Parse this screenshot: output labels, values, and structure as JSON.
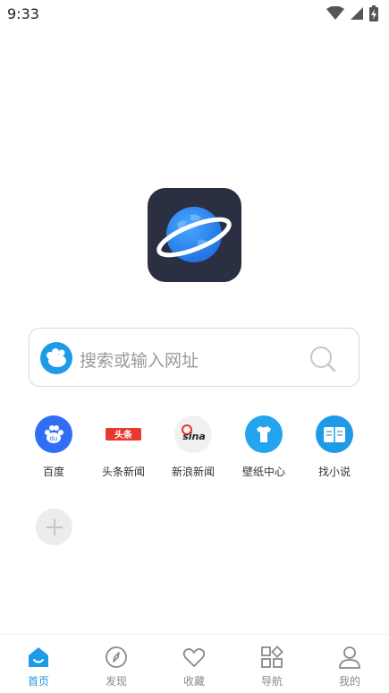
{
  "status_bar": {
    "time": "9:33",
    "icons": [
      "wifi-icon",
      "signal-icon",
      "battery-icon"
    ]
  },
  "app": {
    "logo_icon": "planet-globe-icon"
  },
  "search": {
    "placeholder": "搜索或输入网址",
    "engine_icon": "baidu-paw-icon",
    "search_icon": "search-icon"
  },
  "shortcuts": [
    {
      "label": "百度",
      "icon": "baidu-icon",
      "color": "#2f6ff6"
    },
    {
      "label": "头条新闻",
      "icon": "toutiao-icon",
      "color": "#e8382f"
    },
    {
      "label": "新浪新闻",
      "icon": "sina-icon",
      "color": "#e8362f"
    },
    {
      "label": "壁纸中心",
      "icon": "tshirt-icon",
      "color": "#22a5ee"
    },
    {
      "label": "找小说",
      "icon": "book-icon",
      "color": "#1f9ae7"
    }
  ],
  "add_shortcut": {
    "icon": "plus-icon"
  },
  "bottom_nav": {
    "items": [
      {
        "label": "首页",
        "icon": "home-icon",
        "active": true
      },
      {
        "label": "发现",
        "icon": "compass-icon",
        "active": false
      },
      {
        "label": "收藏",
        "icon": "heart-icon",
        "active": false
      },
      {
        "label": "导航",
        "icon": "grid-icon",
        "active": false
      },
      {
        "label": "我的",
        "icon": "user-icon",
        "active": false
      }
    ]
  },
  "colors": {
    "accent": "#1e9be6",
    "inactive": "#8a8a8a",
    "logo_bg": "#2b2f42"
  }
}
